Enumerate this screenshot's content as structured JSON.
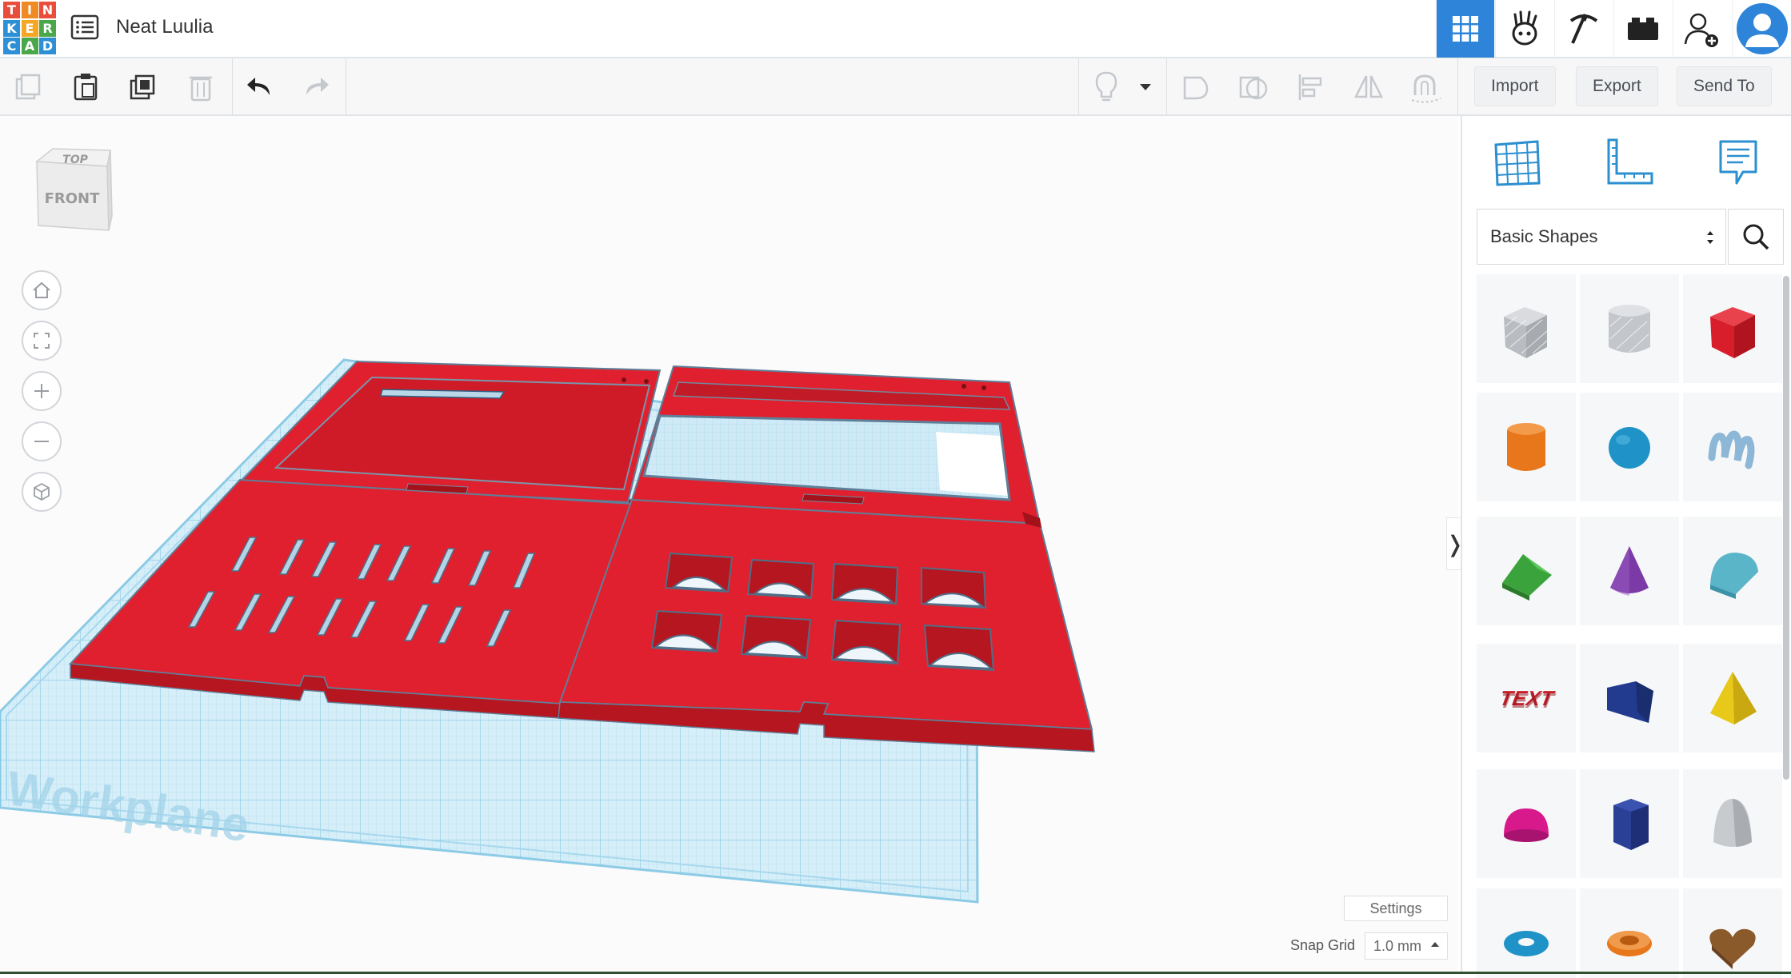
{
  "app": {
    "logo_letters": [
      "T",
      "I",
      "N",
      "K",
      "E",
      "R",
      "C",
      "A",
      "D"
    ],
    "logo_colors": [
      "#e84e3b",
      "#f08a24",
      "#e84e3b",
      "#2d8fd5",
      "#f5a623",
      "#4aa74a",
      "#2d8fd5",
      "#4aa74a",
      "#2d8fd5"
    ],
    "design_title": "Neat Luulia"
  },
  "topnav": {
    "items": [
      "3d-design-grid-icon",
      "circuits-icon",
      "codeblocks-pickaxe-icon",
      "bricks-icon",
      "add-user-icon",
      "profile-avatar-icon"
    ],
    "active_color": "#2d84d8"
  },
  "toolbar": {
    "import_label": "Import",
    "export_label": "Export",
    "send_to_label": "Send To"
  },
  "viewport": {
    "viewcube_top": "TOP",
    "viewcube_front": "FRONT",
    "workplane_label": "Workplane",
    "settings_label": "Settings",
    "snap_grid_label": "Snap Grid",
    "snap_grid_value": "1.0 mm",
    "model_color": "#e0202e",
    "grid_color": "#a9d9ef"
  },
  "panel": {
    "library_selected": "Basic Shapes",
    "shapes": [
      {
        "name": "box-hole",
        "color": "#b9bcc0"
      },
      {
        "name": "cylinder-hole",
        "color": "#c3c6ca"
      },
      {
        "name": "box",
        "color": "#d91e2b"
      },
      {
        "name": "cylinder",
        "color": "#e8761a"
      },
      {
        "name": "sphere",
        "color": "#1f93c8"
      },
      {
        "name": "scribble",
        "color": "#8cb7d6"
      },
      {
        "name": "roof",
        "color": "#3ba33b"
      },
      {
        "name": "cone",
        "color": "#7b3aa6"
      },
      {
        "name": "round-roof",
        "color": "#5ab5c8"
      },
      {
        "name": "text",
        "color": "#c8202a"
      },
      {
        "name": "wedge",
        "color": "#233b8f"
      },
      {
        "name": "pyramid",
        "color": "#e8c818"
      },
      {
        "name": "half-sphere",
        "color": "#d8198c"
      },
      {
        "name": "polygon",
        "color": "#2a3f96"
      },
      {
        "name": "paraboloid",
        "color": "#c8cbce"
      },
      {
        "name": "torus",
        "color": "#1f93c8"
      },
      {
        "name": "tube",
        "color": "#e8761a"
      },
      {
        "name": "heart",
        "color": "#8b5a2b"
      }
    ]
  }
}
